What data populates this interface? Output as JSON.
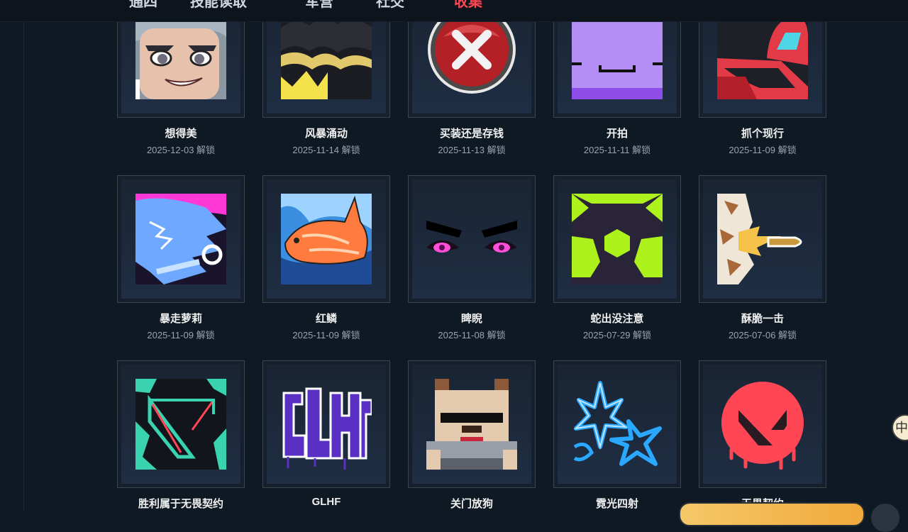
{
  "nav": {
    "items": [
      {
        "label": "通四"
      },
      {
        "label": "技能读取"
      },
      {
        "label": "军营"
      },
      {
        "label": "社交"
      },
      {
        "label": "收集"
      }
    ]
  },
  "cards": [
    {
      "name": "想得美",
      "date": "2025-12-03 解锁",
      "icon": "smug-face-icon"
    },
    {
      "name": "风暴涌动",
      "date": "2025-11-14 解锁",
      "icon": "storm-crown-icon"
    },
    {
      "name": "买装还是存钱",
      "date": "2025-11-13 解锁",
      "icon": "red-x-button-icon"
    },
    {
      "name": "开拍",
      "date": "2025-11-11 解锁",
      "icon": "purple-block-face-icon"
    },
    {
      "name": "抓个现行",
      "date": "2025-11-09 解锁",
      "icon": "visor-sniper-icon"
    },
    {
      "name": "暴走萝莉",
      "date": "2025-11-09 解锁",
      "icon": "neon-shark-icon"
    },
    {
      "name": "红鳞",
      "date": "2025-11-09 解锁",
      "icon": "koi-fish-icon"
    },
    {
      "name": "睥睨",
      "date": "2025-11-08 解锁",
      "icon": "glaring-eyes-icon"
    },
    {
      "name": "蛇出没注意",
      "date": "2025-07-29 解锁",
      "icon": "green-hexagon-icon"
    },
    {
      "name": "酥脆一击",
      "date": "2025-07-06 解锁",
      "icon": "bullet-impact-icon"
    },
    {
      "name": "胜利属于无畏契约",
      "date": "",
      "icon": "valorant-splatter-icon"
    },
    {
      "name": "GLHF",
      "date": "",
      "icon": "glhf-graffiti-icon"
    },
    {
      "name": "关门放狗",
      "date": "",
      "icon": "pixel-dog-icon"
    },
    {
      "name": "霓光四射",
      "date": "",
      "icon": "neon-stars-icon"
    },
    {
      "name": "无畏契约",
      "date": "",
      "icon": "valorant-logo-icon"
    }
  ],
  "colors": {
    "background": "#0f1923",
    "accent": "#ff4655",
    "tile_border": "#3b4550",
    "name_text": "#f0f0f0",
    "date_text": "#9aa3ad"
  },
  "float_button": {
    "icon": "translate-icon",
    "label": "中"
  }
}
